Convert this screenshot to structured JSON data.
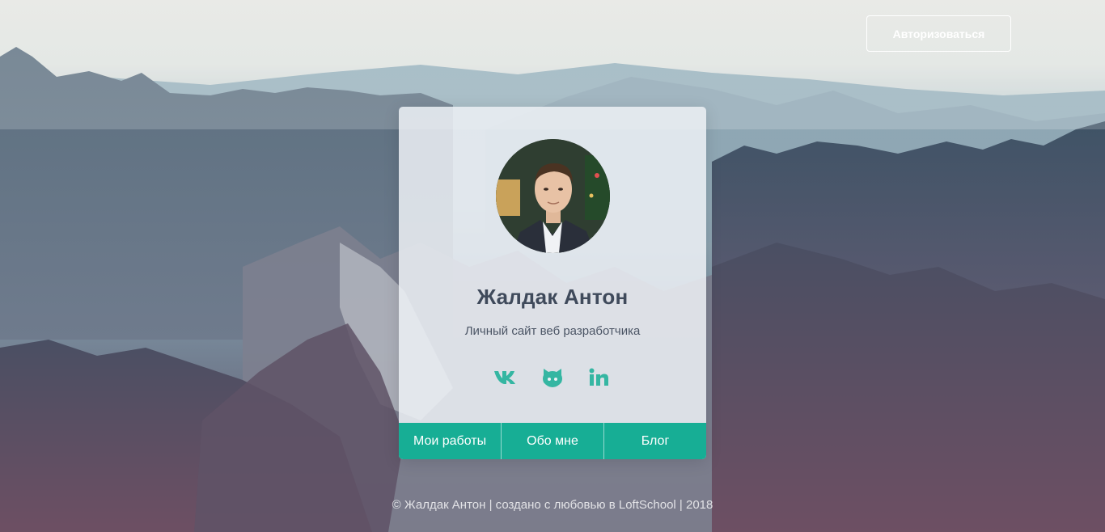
{
  "header": {
    "auth_label": "Авторизоваться"
  },
  "profile": {
    "name": "Жалдак Антон",
    "subtitle": "Личный сайт веб разработчика",
    "socials": [
      {
        "icon": "vk-icon"
      },
      {
        "icon": "github-icon"
      },
      {
        "icon": "linkedin-icon"
      }
    ]
  },
  "nav": {
    "items": [
      {
        "label": "Мои работы"
      },
      {
        "label": "Обо мне"
      },
      {
        "label": "Блог"
      }
    ]
  },
  "footer": {
    "text": "© Жалдак Антон | создано с любовью в LoftSchool | 2018"
  },
  "colors": {
    "accent": "#17ae95",
    "heading": "#3f4a5b",
    "text": "#4c5666"
  }
}
